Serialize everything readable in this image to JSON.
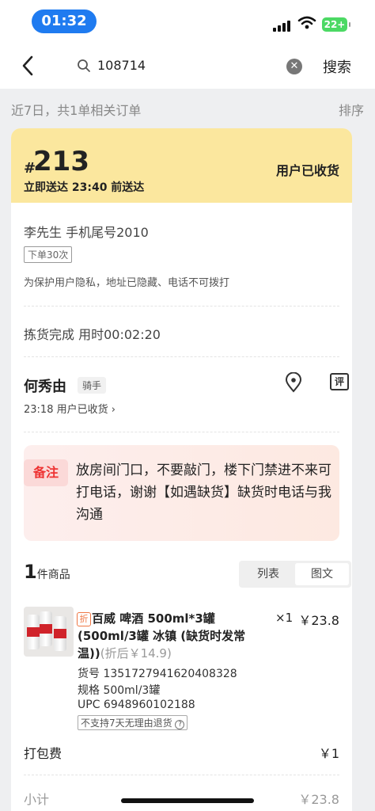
{
  "status_bar": {
    "time": "01:32",
    "battery": "22+"
  },
  "nav": {
    "search_value": "108714",
    "search_button": "搜索"
  },
  "filter": {
    "summary": "近7日，共1单相关订单",
    "sort": "排序"
  },
  "order": {
    "hash": "#",
    "number": "213",
    "deliver": "立即送达 23:40 前送达",
    "status": "用户已收货",
    "customer": "李先生 手机尾号2010",
    "order_count": "下单30次",
    "privacy": "为保护用户隐私，地址已隐藏、电话不可拨打",
    "picking": "拣货完成 用时00:02:20",
    "rider": {
      "name": "何秀由",
      "tag": "骑手",
      "status": "23:18 用户已收货 ›"
    },
    "rate_icon_text": "评",
    "note": {
      "label": "备注",
      "text": "放房间门口，不要敲门，楼下门禁进不来可打电话，谢谢【如遇缺货】缺货时电话与我沟通"
    },
    "goods": {
      "count": "1",
      "unit": "件商品",
      "tabs": [
        "列表",
        "图文"
      ],
      "active_tab": "图文"
    },
    "product": {
      "discount_tag": "折",
      "name": "百威 啤酒 500ml*3罐(500ml/3罐 冰镇 (缺货时发常温))",
      "after_discount": "(折后￥14.9)",
      "qty": "×1",
      "price": "￥23.8",
      "sku": "货号 1351727941620408328",
      "spec": "规格 500ml/3罐",
      "upc": "UPC 6948960102188",
      "return_policy": "不支持7天无理由退货"
    },
    "packing": {
      "label": "打包费",
      "value": "￥1"
    },
    "subtotal": {
      "label": "小计",
      "value": "￥23.8"
    }
  },
  "colors": {
    "header_yellow": "#fbe79e",
    "note_red": "#e33",
    "time_blue": "#1f7bf0"
  }
}
